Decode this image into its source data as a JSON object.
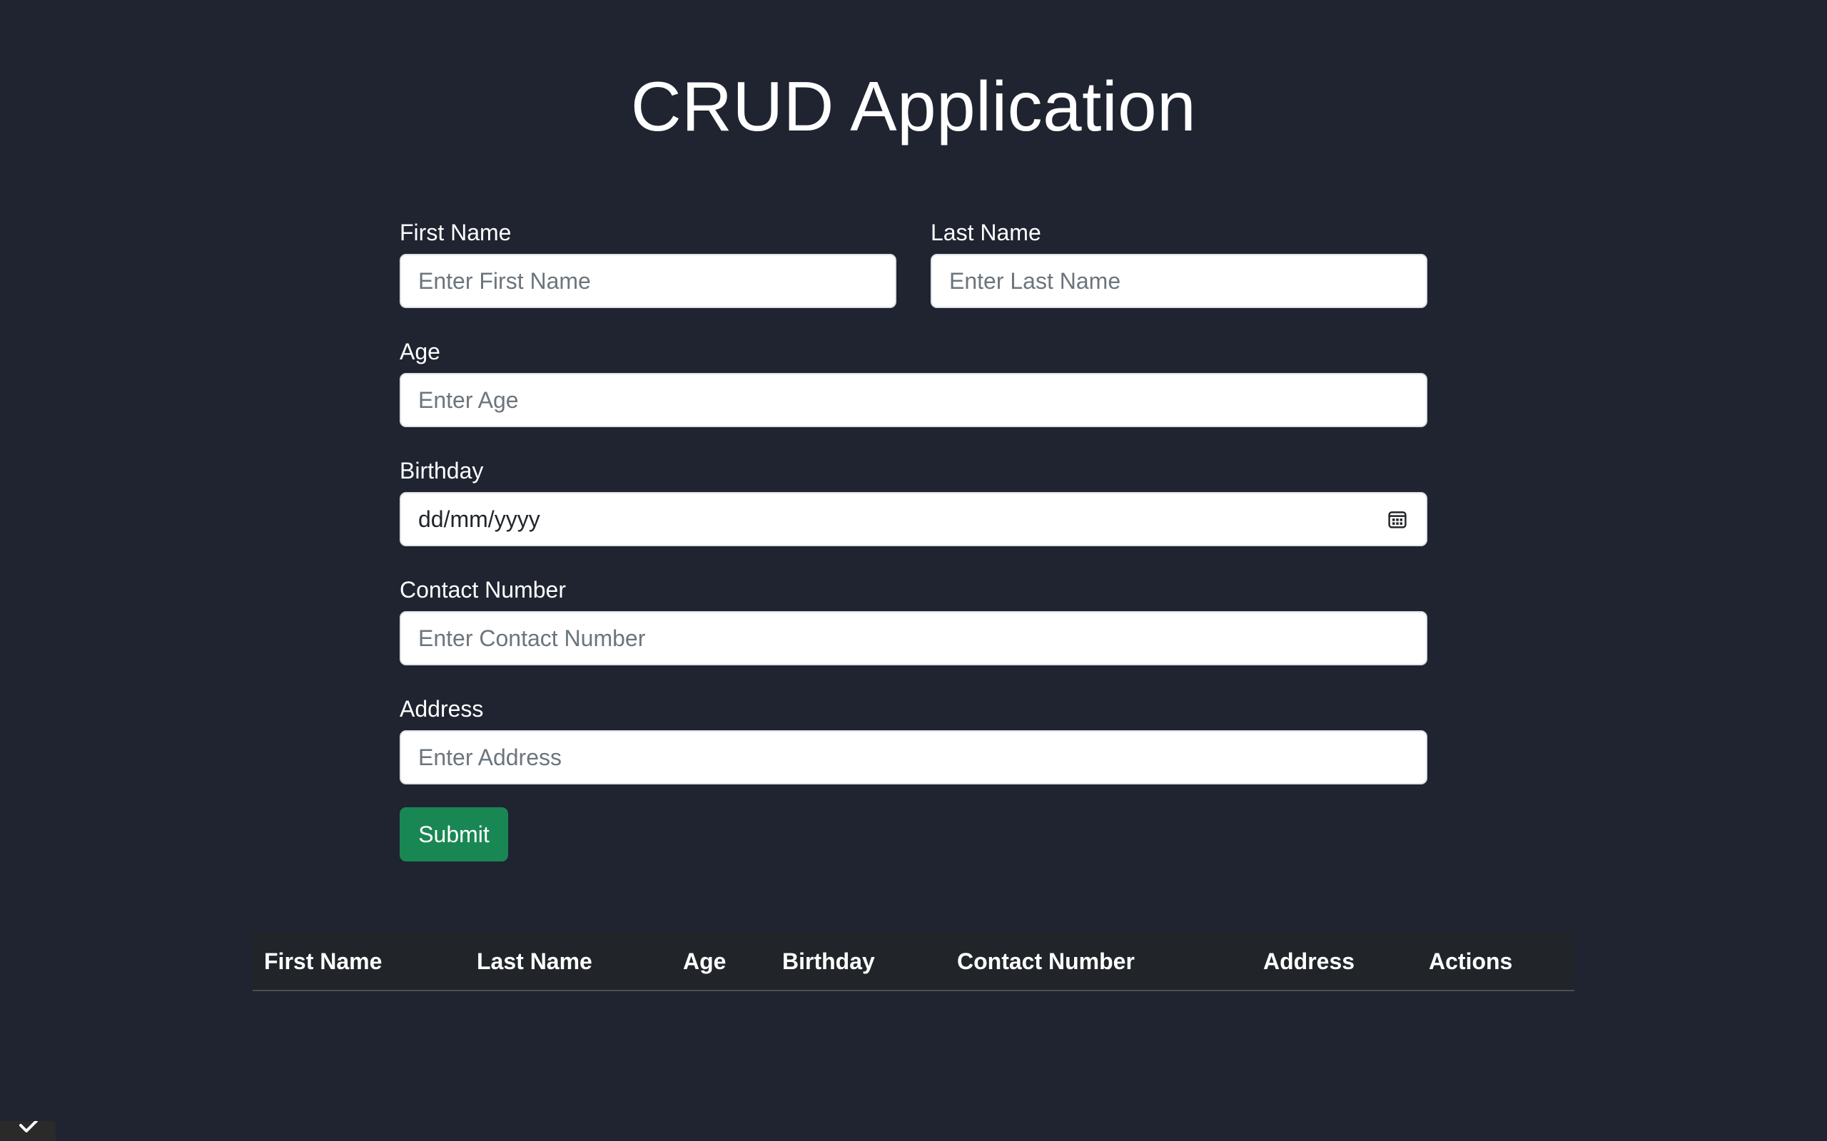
{
  "page": {
    "title": "CRUD Application"
  },
  "form": {
    "first_name": {
      "label": "First Name",
      "placeholder": "Enter First Name"
    },
    "last_name": {
      "label": "Last Name",
      "placeholder": "Enter Last Name"
    },
    "age": {
      "label": "Age",
      "placeholder": "Enter Age"
    },
    "birthday": {
      "label": "Birthday",
      "value": "dd/mm/yyyy",
      "icon": "calendar-icon"
    },
    "contact_number": {
      "label": "Contact Number",
      "placeholder": "Enter Contact Number"
    },
    "address": {
      "label": "Address",
      "placeholder": "Enter Address"
    },
    "submit_label": "Submit"
  },
  "table": {
    "headers": [
      "First Name",
      "Last Name",
      "Age",
      "Birthday",
      "Contact Number",
      "Address",
      "Actions"
    ],
    "rows": []
  },
  "colors": {
    "background": "#1f2430",
    "submit": "#198754",
    "table_header_bg": "#212529"
  }
}
